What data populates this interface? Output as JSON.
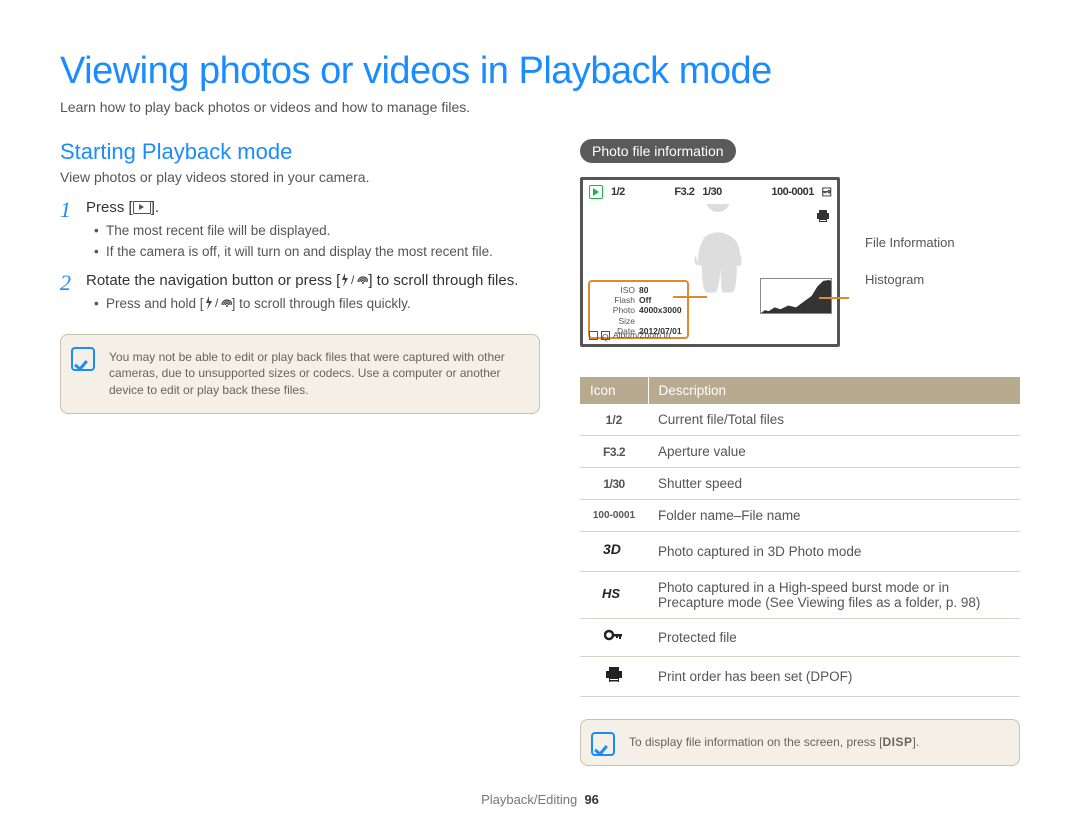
{
  "header": {
    "title": "Viewing photos or videos in Playback mode",
    "intro": "Learn how to play back photos or videos and how to manage files."
  },
  "left": {
    "h2": "Starting Playback mode",
    "sub": "View photos or play videos stored in your camera.",
    "step1": {
      "num": "1",
      "line_pre": "Press [",
      "line_post": "].",
      "bullets": [
        "The most recent file will be displayed.",
        "If the camera is off, it will turn on and display the most recent file."
      ]
    },
    "step2": {
      "num": "2",
      "line_a": "Rotate the navigation button or press [",
      "line_b": "] to scroll through files.",
      "bullet_a": "Press and hold [",
      "bullet_b": "] to scroll through files quickly."
    },
    "note": "You may not be able to edit or play back files that were captured with other cameras, due to unsupported sizes or codecs. Use a computer or another device to edit or play back these files."
  },
  "right": {
    "badge": "Photo file information",
    "lcd": {
      "count": "1/2",
      "aperture": "F3.2",
      "shutter": "1/30",
      "folder": "100-0001",
      "info_rows": [
        {
          "k": "ISO",
          "v": "80"
        },
        {
          "k": "Flash",
          "v": "Off"
        },
        {
          "k": "Photo Size",
          "v": "4000x3000"
        },
        {
          "k": "Date",
          "v": "2012/07/01"
        }
      ],
      "foot": "Album/Zoom In"
    },
    "callouts": {
      "file_info": "File Information",
      "histogram": "Histogram"
    },
    "table": {
      "head_icon": "Icon",
      "head_desc": "Description",
      "rows": [
        {
          "icon_text": "1/2",
          "desc": "Current file/Total files"
        },
        {
          "icon_text": "F3.2",
          "desc": "Aperture value"
        },
        {
          "icon_text": "1/30",
          "desc": "Shutter speed"
        },
        {
          "icon_text": "100-0001",
          "desc": "Folder name–File name"
        },
        {
          "icon_svg": "3d",
          "desc": "Photo captured in 3D Photo mode"
        },
        {
          "icon_svg": "hs",
          "desc": "Photo captured in a High-speed burst mode or in Precapture mode (See Viewing files as a folder, p. 98)"
        },
        {
          "icon_svg": "key",
          "desc": "Protected file"
        },
        {
          "icon_svg": "print",
          "desc": "Print order has been set (DPOF)"
        }
      ]
    },
    "note2_a": "To display file information on the screen, press [",
    "note2_b": "].",
    "disp": "DISP"
  },
  "footer": {
    "section": "Playback/Editing",
    "page": "96"
  }
}
